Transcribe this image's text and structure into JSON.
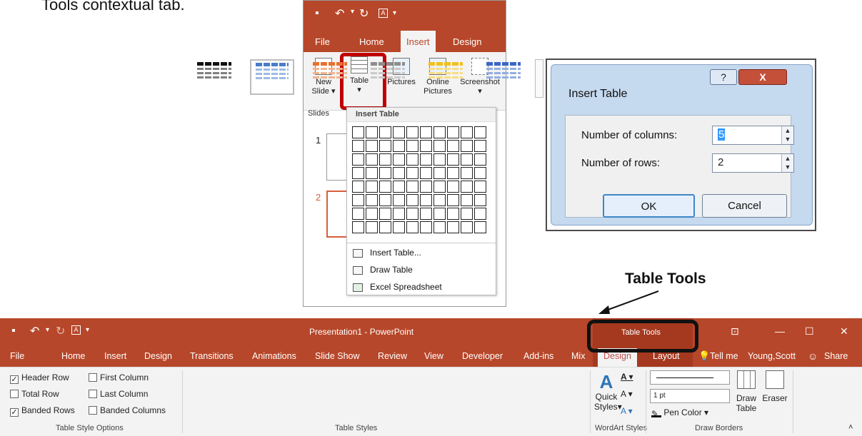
{
  "intro": {
    "text": "Tools contextual tab."
  },
  "snippet": {
    "tabs": {
      "file": "File",
      "home": "Home",
      "insert": "Insert",
      "design": "Design"
    },
    "ribbon": {
      "new_slide": "New Slide",
      "new_slide_arrow": "▾",
      "table": "Table",
      "table_arrow": "▾",
      "pictures": "Pictures",
      "online_pictures": "Online Pictures",
      "screenshot": "Screenshot",
      "screenshot_arrow": "▾",
      "slides_group": "Slides"
    },
    "thumbnails": [
      "1",
      "2"
    ],
    "dropdown": {
      "header": "Insert Table",
      "grid_columns": 10,
      "grid_rows": 8,
      "items": [
        "Insert Table...",
        "Draw Table",
        "Excel Spreadsheet"
      ]
    }
  },
  "dialog": {
    "title": "Insert Table",
    "help": "?",
    "close": "X",
    "columns_label": "Number of columns:",
    "columns_value": "5",
    "rows_label": "Number of rows:",
    "rows_value": "2",
    "ok": "OK",
    "cancel": "Cancel"
  },
  "annotation": {
    "label": "Table Tools"
  },
  "app": {
    "window_title": "Presentation1 - PowerPoint",
    "context_title": "Table Tools",
    "colors": {
      "brand": "#b7472a",
      "context": "#a5391f",
      "highlight": "#c00000"
    },
    "tabs": [
      "File",
      "Home",
      "Insert",
      "Design",
      "Transitions",
      "Animations",
      "Slide Show",
      "Review",
      "View",
      "Developer",
      "Add-ins",
      "Mix"
    ],
    "context_tabs": {
      "design": "Design",
      "layout": "Layout"
    },
    "tell_me": "Tell me",
    "user": "Young,Scott",
    "share": "Share",
    "style_options": {
      "header_row": "Header Row",
      "first_column": "First Column",
      "total_row": "Total Row",
      "last_column": "Last Column",
      "banded_rows": "Banded Rows",
      "banded_columns": "Banded Columns",
      "checked": {
        "header_row": true,
        "first_column": false,
        "total_row": false,
        "last_column": false,
        "banded_rows": true,
        "banded_columns": false
      },
      "group": "Table Style Options"
    },
    "table_styles": {
      "group": "Table Styles",
      "swatches": [
        {
          "header": "#111111",
          "line": "#7f7f7f"
        },
        {
          "header": "#4a7cc9",
          "line": "#9dbbe3"
        },
        {
          "header": "#e8712d",
          "line": "#f2b48f"
        },
        {
          "header": "#8d8d8d",
          "line": "#c9c9c9"
        },
        {
          "header": "#f2c11a",
          "line": "#f8dd84"
        },
        {
          "header": "#3c66c8",
          "line": "#93aee3"
        }
      ]
    },
    "wordart": {
      "quick": "Quick",
      "styles": "Styles",
      "styles_arrow": "▾",
      "group": "WordArt Styles"
    },
    "draw_borders": {
      "pen_weight": "1 pt",
      "pen_color": "Pen Color",
      "draw_table_l1": "Draw",
      "draw_table_l2": "Table",
      "eraser": "Eraser",
      "group": "Draw Borders"
    }
  }
}
